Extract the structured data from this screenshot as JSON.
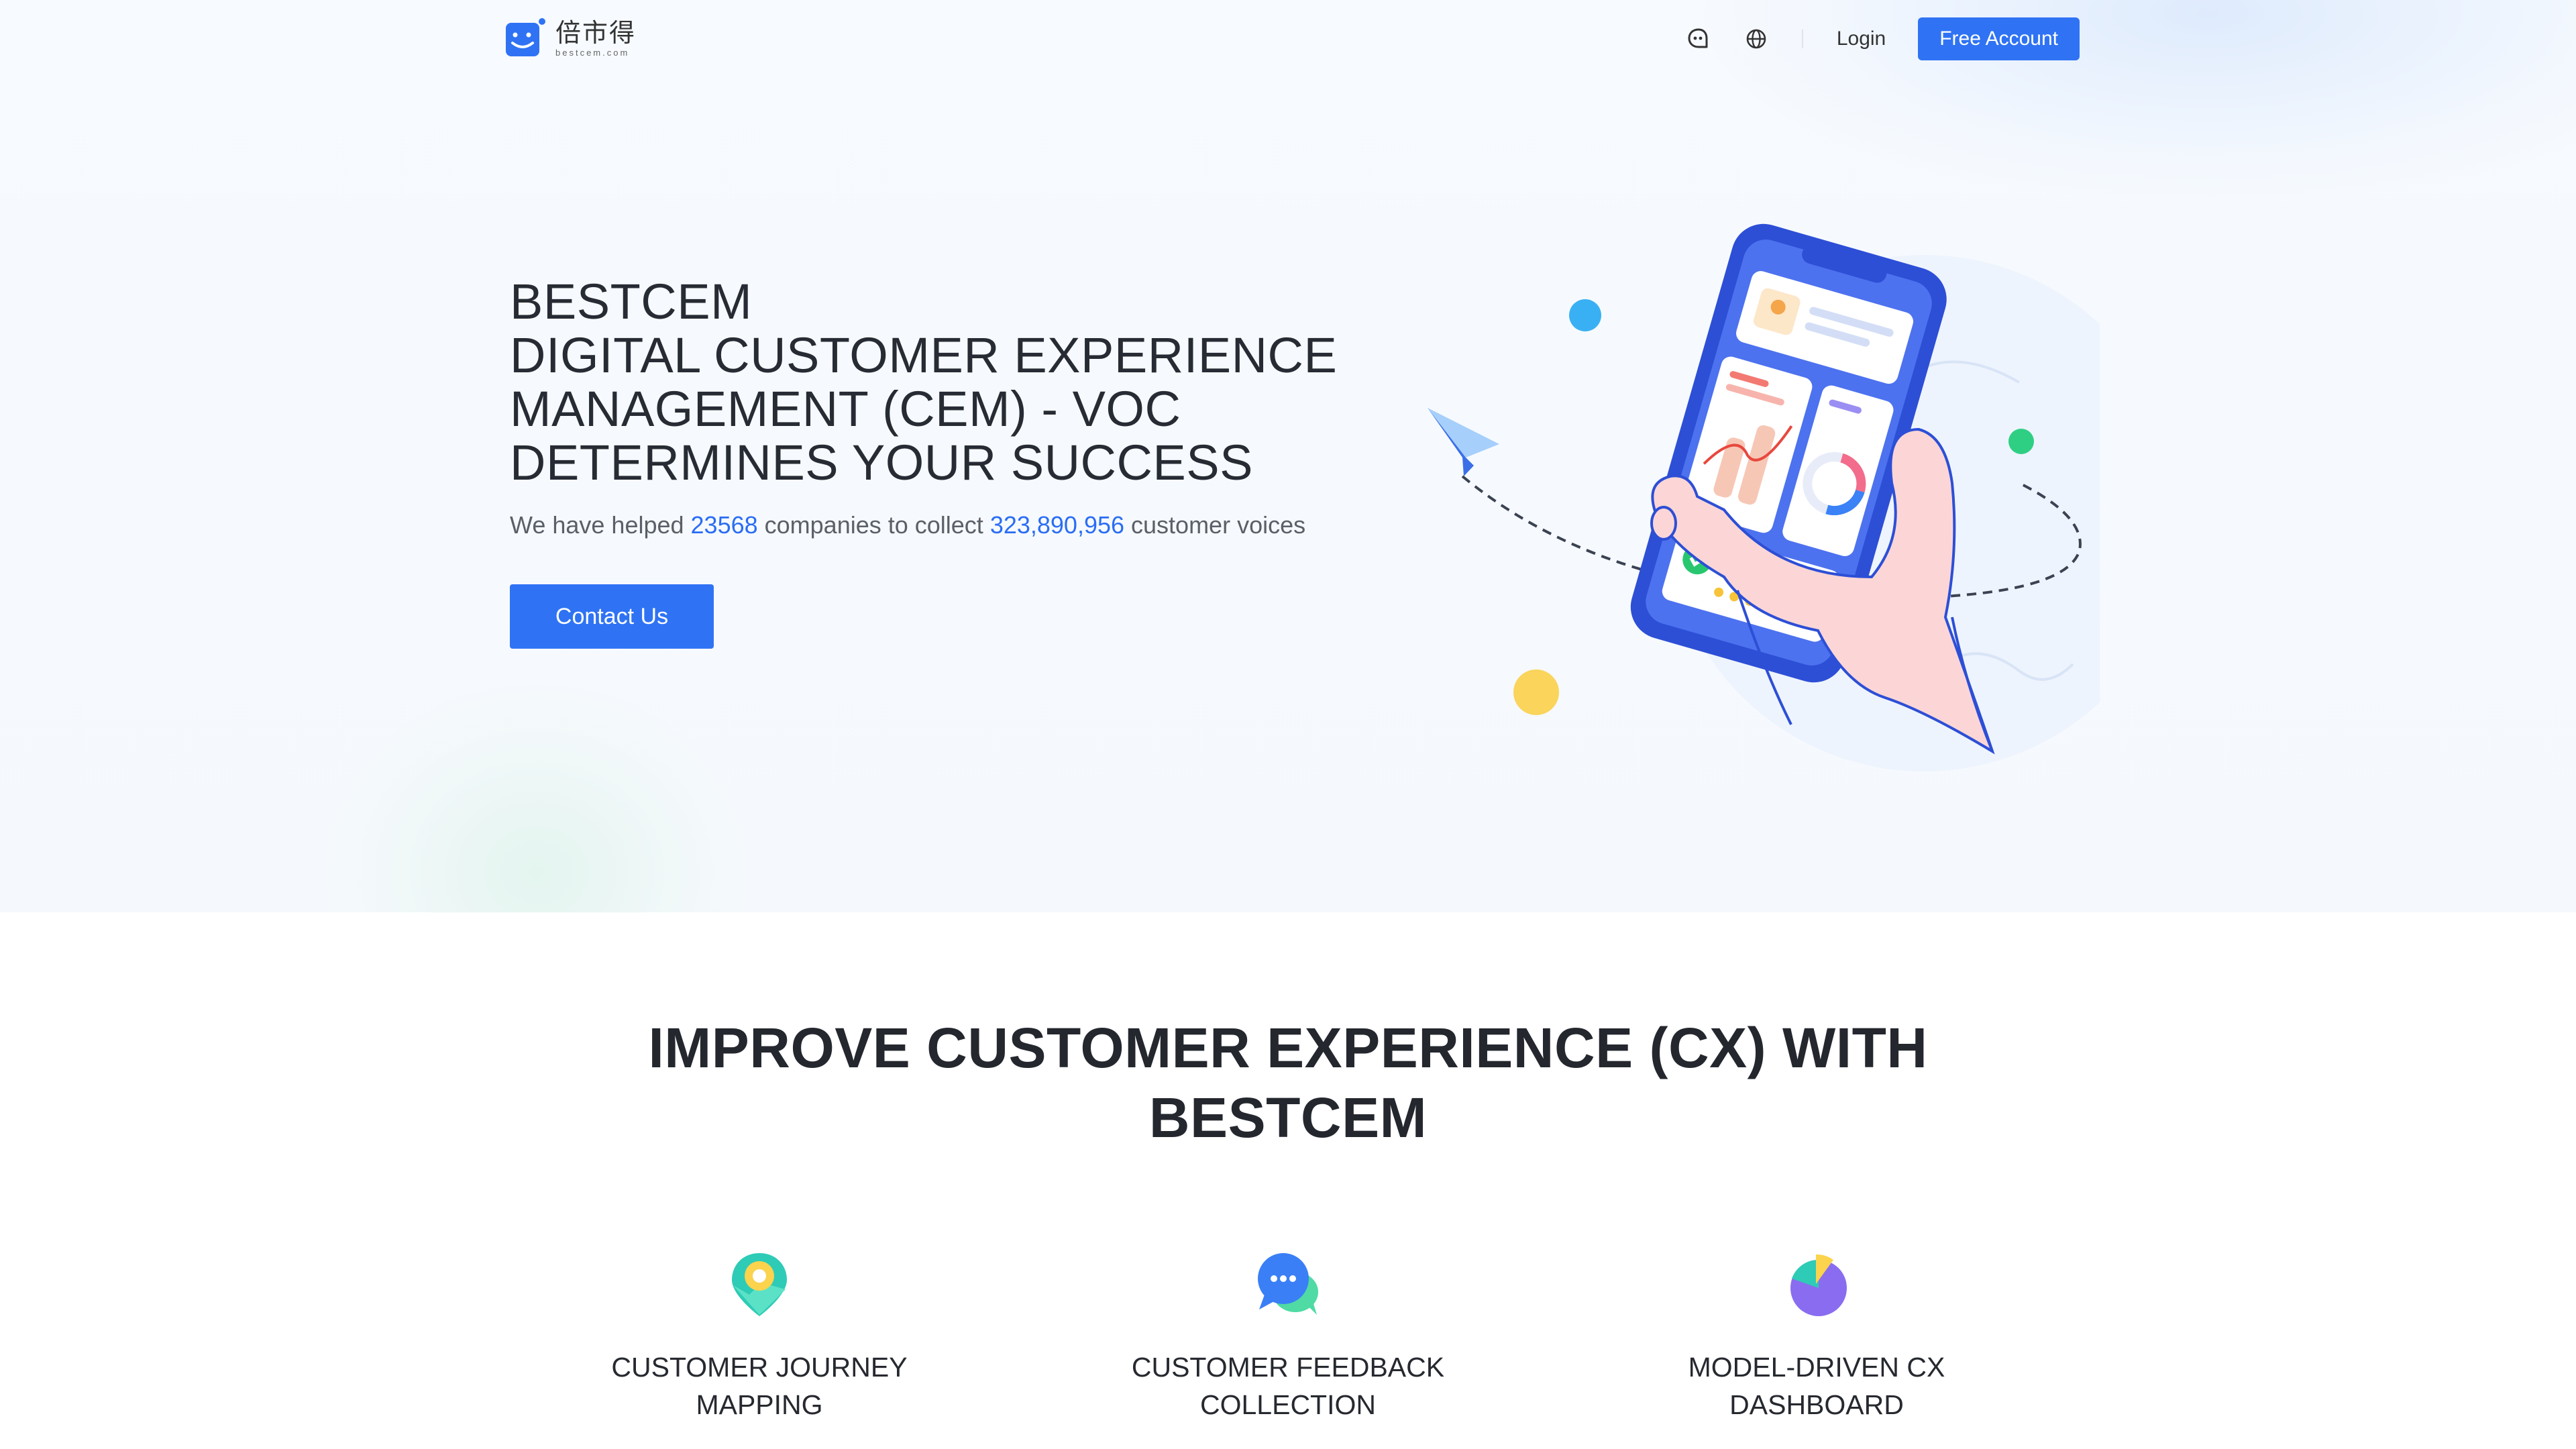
{
  "header": {
    "logo_cn": "倍市得",
    "logo_en": "bestcem.com",
    "icons": [
      "support-chat-icon",
      "globe-icon"
    ],
    "login_label": "Login",
    "free_account_label": "Free Account"
  },
  "hero": {
    "title_lines": [
      "BESTCEM",
      "DIGITAL CUSTOMER EXPERIENCE",
      "MANAGEMENT (CEM) - VOC",
      "DETERMINES YOUR SUCCESS"
    ],
    "subtitle": {
      "prefix": "We have helped ",
      "companies": "23568",
      "middle": " companies to collect ",
      "voices": "323,890,956",
      "suffix": " customer voices"
    },
    "contact_label": "Contact Us"
  },
  "section": {
    "title_line1": "IMPROVE CUSTOMER EXPERIENCE (CX) WITH",
    "title_line2": "BESTCEM",
    "features": [
      {
        "icon": "journey-map-pin-icon",
        "line1": "CUSTOMER JOURNEY",
        "line2": "MAPPING"
      },
      {
        "icon": "feedback-chat-icon",
        "line1": "CUSTOMER FEEDBACK",
        "line2": "COLLECTION"
      },
      {
        "icon": "pie-dashboard-icon",
        "line1": "MODEL-DRIVEN CX",
        "line2": "DASHBOARD"
      }
    ]
  },
  "colors": {
    "accent": "#2f73f4",
    "number_highlight": "#2a6df4",
    "title_text": "#272b33"
  }
}
